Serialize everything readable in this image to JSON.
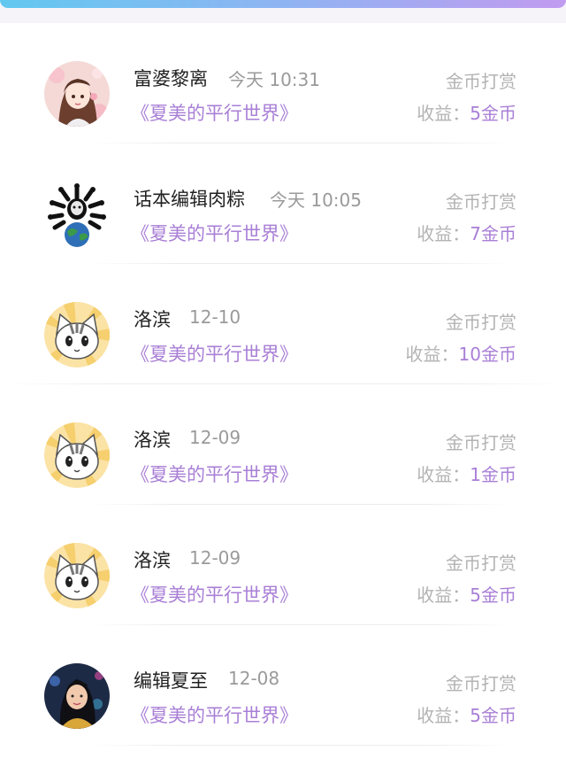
{
  "colors": {
    "accent": "#a97fd6",
    "muted": "#b3b3b3",
    "name": "#222222"
  },
  "records": [
    {
      "name": "富婆黎离",
      "time": "今天 10:31",
      "book": "《夏美的平行世界》",
      "type": "金币打赏",
      "earn_label": "收益：",
      "earn_value": "5金币",
      "avatar": "anime-girl-avatar"
    },
    {
      "name": "话本编辑肉粽",
      "time": "今天 10:05",
      "book": "《夏美的平行世界》",
      "type": "金币打赏",
      "earn_label": "收益：",
      "earn_value": "7金币",
      "avatar": "skull-crossbones-earth-avatar"
    },
    {
      "name": "洛滨",
      "time": "12-10",
      "book": "《夏美的平行世界》",
      "type": "金币打赏",
      "earn_label": "收益：",
      "earn_value": "10金币",
      "avatar": "cat-avatar"
    },
    {
      "name": "洛滨",
      "time": "12-09",
      "book": "《夏美的平行世界》",
      "type": "金币打赏",
      "earn_label": "收益：",
      "earn_value": "1金币",
      "avatar": "cat-avatar"
    },
    {
      "name": "洛滨",
      "time": "12-09",
      "book": "《夏美的平行世界》",
      "type": "金币打赏",
      "earn_label": "收益：",
      "earn_value": "5金币",
      "avatar": "cat-avatar"
    },
    {
      "name": "编辑夏至",
      "time": "12-08",
      "book": "《夏美的平行世界》",
      "type": "金币打赏",
      "earn_label": "收益：",
      "earn_value": "5金币",
      "avatar": "woman-photo-avatar"
    }
  ]
}
